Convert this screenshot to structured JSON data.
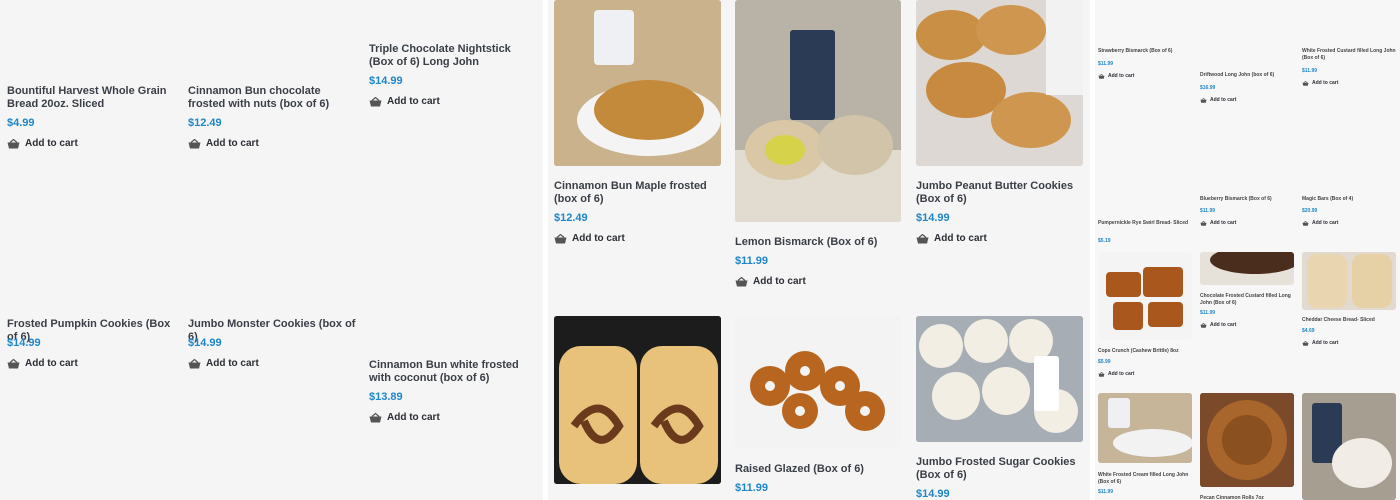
{
  "cart_label": "Add to cart",
  "panel1": [
    {
      "title": "Bountiful Harvest Whole Grain Bread 20oz. Sliced",
      "price": "$4.99"
    },
    {
      "title": "Cinnamon Bun chocolate frosted with nuts (box of 6)",
      "price": "$12.49"
    },
    {
      "title": "Triple Chocolate Nightstick (Box of 6) Long John",
      "price": "$14.99"
    },
    {
      "title": "Frosted Pumpkin Cookies (Box of 6)",
      "price": "$14.99"
    },
    {
      "title": "Jumbo Monster Cookies (box of 6)",
      "price": "$14.99"
    },
    {
      "title": "Cinnamon Bun white frosted with coconut (box of 6)",
      "price": "$13.89"
    }
  ],
  "panel2": [
    {
      "title": "Cinnamon Bun Maple frosted (box of 6)",
      "price": "$12.49",
      "image": "maple-bun-photo"
    },
    {
      "title": "Lemon Bismarck (Box of 6)",
      "price": "$11.99",
      "image": "lemon-bismarck-photo"
    },
    {
      "title": "Jumbo Peanut Butter Cookies (Box of 6)",
      "price": "$14.99",
      "image": "peanut-butter-cookies-photo"
    },
    {
      "title": "",
      "price": "",
      "image": "cinnamon-swirl-bread-photo"
    },
    {
      "title": "Raised Glazed (Box of 6)",
      "price": "$11.99",
      "image": "raised-glazed-donuts-photo"
    },
    {
      "title": "Jumbo Frosted Sugar Cookies (Box of 6)",
      "price": "$14.99",
      "image": "sugar-cookies-photo"
    }
  ],
  "panel3": [
    {
      "title": "Strawberry Bismarck (Box of 6)",
      "price": "$11.99"
    },
    {
      "title": "Driftwood Long John (box of 6)",
      "price": "$16.99"
    },
    {
      "title": "White Frosted Custard filled Long John (Box of 6)",
      "price": "$11.99"
    },
    {
      "title": "Pumpernickle Rye Swirl Bread- Sliced",
      "price": "$5.19"
    },
    {
      "title": "Blueberry Bismarck (Box of 6)",
      "price": "$11.99"
    },
    {
      "title": "Magic Bars (Box of 4)",
      "price": "$20.99"
    },
    {
      "title": "Cops Crunch (Cashew Brittle) 8oz",
      "price": "$5.99"
    },
    {
      "title": "Chocolate Frosted Custard filled Long John (Box of 6)",
      "price": "$11.99"
    },
    {
      "title": "Cheddar Cheese Bread- Sliced",
      "price": "$4.69"
    },
    {
      "title": "White Frosted Cream filled Long John (Box of 6)",
      "price": "$11.99"
    },
    {
      "title": "Pecan Cinnamon Rolls 7oz",
      "price": ""
    },
    {
      "title": "",
      "price": ""
    }
  ],
  "colors": {
    "price": "#1f86c9",
    "title": "#3a3f47",
    "background": "#f5f5f5"
  }
}
